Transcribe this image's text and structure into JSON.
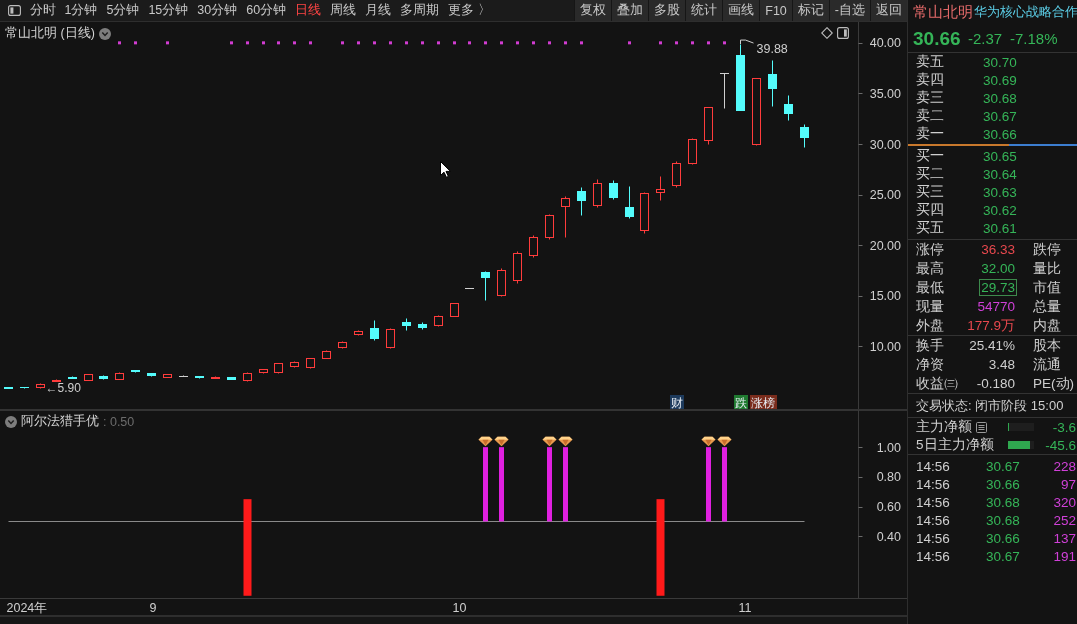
{
  "toolbar": {
    "periods": [
      {
        "label": "分时",
        "selected": false
      },
      {
        "label": "1分钟",
        "selected": false
      },
      {
        "label": "5分钟",
        "selected": false
      },
      {
        "label": "15分钟",
        "selected": false
      },
      {
        "label": "30分钟",
        "selected": false
      },
      {
        "label": "60分钟",
        "selected": false
      },
      {
        "label": "日线",
        "selected": true
      },
      {
        "label": "周线",
        "selected": false
      },
      {
        "label": "月线",
        "selected": false
      },
      {
        "label": "多周期",
        "selected": false
      },
      {
        "label": "更多 〉",
        "selected": false
      }
    ],
    "buttons": [
      "复权",
      "叠加",
      "多股",
      "统计",
      "画线",
      "F10",
      "标记",
      "-自选",
      "返回"
    ]
  },
  "main_chart": {
    "chart_data": [
      {
        "type": "candlestick",
        "title": "常山北明 (日线)",
        "categories": [
          null,
          null,
          null,
          null,
          null,
          null,
          null,
          null,
          null,
          null,
          null,
          null,
          null,
          null,
          null,
          null,
          null,
          null,
          null,
          null,
          null,
          null,
          null,
          null,
          null,
          null,
          null,
          null,
          null,
          null,
          null,
          null,
          null,
          null,
          null,
          null,
          null,
          null,
          null,
          null,
          null,
          null,
          null,
          null,
          null,
          null,
          null,
          null,
          null,
          null,
          null,
          null,
          null,
          null,
          null,
          null,
          null
        ],
        "tick_labels": "y",
        "ylim": [
          3.72,
          42.06
        ],
        "yticks": [
          {
            "value": 10,
            "label": "10.00"
          },
          {
            "value": 15,
            "label": "15.00"
          },
          {
            "value": 20,
            "label": "20.00"
          },
          {
            "value": 25,
            "label": "25.00"
          },
          {
            "value": 30,
            "label": "30.00"
          },
          {
            "value": 35,
            "label": "35.00"
          },
          {
            "value": 40,
            "label": "40.00"
          }
        ],
        "ohlc": [
          [
            5.98,
            6.0,
            5.92,
            5.94
          ],
          [
            5.98,
            6.0,
            5.93,
            5.95
          ],
          [
            5.95,
            6.35,
            5.9,
            6.3
          ],
          [
            6.6,
            6.78,
            6.55,
            6.7
          ],
          [
            7.0,
            7.05,
            6.85,
            6.9
          ],
          [
            6.7,
            7.3,
            6.65,
            7.25
          ],
          [
            7.1,
            7.15,
            6.8,
            6.85
          ],
          [
            6.8,
            7.45,
            6.75,
            7.4
          ],
          [
            7.65,
            7.7,
            7.5,
            7.55
          ],
          [
            7.35,
            7.4,
            7.1,
            7.15
          ],
          [
            7.0,
            7.3,
            6.95,
            7.25
          ],
          [
            7.1,
            7.15,
            7.05,
            7.1
          ],
          [
            7.05,
            7.1,
            6.9,
            6.95
          ],
          [
            6.9,
            7.05,
            6.85,
            7.0
          ],
          [
            6.95,
            7.0,
            6.75,
            6.8
          ],
          [
            6.7,
            7.45,
            6.6,
            7.4
          ],
          [
            7.45,
            7.8,
            7.4,
            7.75
          ],
          [
            7.5,
            8.4,
            7.4,
            8.35
          ],
          [
            8.1,
            8.6,
            8.0,
            8.5
          ],
          [
            8.0,
            8.9,
            7.9,
            8.85
          ],
          [
            8.9,
            9.6,
            8.85,
            9.55
          ],
          [
            9.9,
            10.5,
            9.8,
            10.4
          ],
          [
            11.2,
            11.6,
            11.1,
            11.5
          ],
          [
            11.8,
            12.6,
            10.6,
            10.8
          ],
          [
            9.9,
            11.8,
            9.8,
            11.7
          ],
          [
            12.4,
            12.8,
            11.6,
            12.1
          ],
          [
            12.2,
            12.4,
            11.7,
            11.9
          ],
          [
            12.1,
            13.1,
            12.0,
            13.0
          ],
          [
            13.0,
            14.3,
            13.0,
            14.3
          ],
          [
            15.73,
            15.73,
            15.73,
            15.73
          ],
          [
            17.35,
            17.5,
            14.6,
            16.86
          ],
          [
            15.1,
            17.8,
            15.0,
            17.6
          ],
          [
            16.6,
            19.4,
            16.3,
            19.2
          ],
          [
            19.0,
            21.0,
            18.8,
            20.8
          ],
          [
            20.8,
            23.1,
            20.6,
            23.0
          ],
          [
            23.9,
            24.9,
            20.8,
            24.7
          ],
          [
            25.4,
            25.8,
            23.0,
            24.5
          ],
          [
            24.0,
            26.5,
            23.8,
            26.2
          ],
          [
            26.2,
            26.4,
            24.6,
            24.8
          ],
          [
            23.8,
            25.9,
            22.7,
            22.9
          ],
          [
            21.5,
            25.3,
            21.2,
            25.2
          ],
          [
            25.3,
            26.8,
            24.5,
            25.6
          ],
          [
            26.0,
            28.3,
            25.8,
            28.1
          ],
          [
            28.1,
            30.6,
            28.0,
            30.5
          ],
          [
            30.4,
            33.66,
            30.0,
            33.66
          ],
          [
            37.03,
            37.03,
            33.6,
            37.03
          ],
          [
            38.8,
            39.88,
            33.4,
            33.4
          ],
          [
            30.0,
            36.5,
            29.9,
            36.5
          ],
          [
            36.9,
            38.3,
            33.75,
            35.5
          ],
          [
            34.0,
            34.84,
            32.4,
            33.03
          ],
          [
            31.7,
            32.0,
            29.73,
            30.66
          ],
          null,
          null,
          null,
          null,
          null,
          null
        ],
        "series": [
          {
            "type": "scatter",
            "color": "#d23cd2",
            "values": [
              null,
              null,
              null,
              null,
              null,
              null,
              null,
              40,
              40,
              null,
              40,
              null,
              null,
              null,
              40,
              40,
              40,
              40,
              40,
              40,
              null,
              40,
              40,
              40,
              40,
              40,
              40,
              40,
              40,
              40,
              40,
              40,
              40,
              40,
              40,
              40,
              40,
              null,
              null,
              40,
              null,
              40,
              40,
              40,
              40,
              40,
              null,
              null,
              null,
              null,
              null,
              null,
              null,
              null,
              null,
              null,
              null
            ]
          }
        ],
        "annotations": [
          "←5.90",
          "39.88"
        ]
      }
    ],
    "event_tags": [
      {
        "text": "财",
        "color": "#1d3a5c"
      },
      {
        "text": "跌",
        "color": "#1f7a30"
      },
      {
        "text": "涨榜",
        "color": "#7a2c1c"
      }
    ]
  },
  "indicator": {
    "reading": ": 0.50",
    "chart_data": [
      {
        "type": "bar",
        "title": "阿尔法猎手优",
        "categories": [
          "2024年",
          null,
          null,
          null,
          null,
          null,
          null,
          null,
          null,
          "9",
          null,
          null,
          null,
          null,
          null,
          null,
          null,
          null,
          null,
          null,
          null,
          null,
          null,
          null,
          null,
          null,
          null,
          null,
          "10",
          null,
          null,
          null,
          null,
          null,
          null,
          null,
          null,
          null,
          null,
          null,
          null,
          null,
          null,
          null,
          null,
          null,
          "11",
          null,
          null,
          null,
          null,
          null,
          null,
          null,
          null,
          null,
          null
        ],
        "ylim": [
          -0.015,
          1.25
        ],
        "yticks": [
          {
            "value": 0.4,
            "label": "0.40"
          },
          {
            "value": 0.6,
            "label": "0.60"
          },
          {
            "value": 0.8,
            "label": "0.80"
          },
          {
            "value": 1,
            "label": "1.00"
          }
        ],
        "series": [
          {
            "color": "#ff1a1a",
            "values": [
              null,
              null,
              null,
              null,
              null,
              null,
              null,
              null,
              null,
              null,
              null,
              null,
              null,
              null,
              null,
              0.65,
              null,
              null,
              null,
              null,
              null,
              null,
              null,
              null,
              null,
              null,
              null,
              null,
              null,
              null,
              null,
              null,
              null,
              null,
              null,
              null,
              null,
              null,
              null,
              null,
              null,
              0.65,
              null,
              null,
              null,
              null,
              null,
              null,
              null,
              null,
              null,
              null,
              null,
              null,
              null,
              null,
              null
            ]
          },
          {
            "color": "#e020e0",
            "base": [
              null,
              null,
              null,
              null,
              null,
              null,
              null,
              null,
              null,
              null,
              null,
              null,
              null,
              null,
              null,
              null,
              null,
              null,
              null,
              null,
              null,
              null,
              null,
              null,
              null,
              null,
              null,
              null,
              null,
              null,
              0.5,
              0.5,
              null,
              null,
              0.5,
              0.5,
              null,
              null,
              null,
              null,
              null,
              null,
              null,
              null,
              0.5,
              0.5,
              null,
              null,
              null,
              null,
              null,
              null,
              null,
              null,
              null,
              null,
              null
            ],
            "values": [
              null,
              null,
              null,
              null,
              null,
              null,
              null,
              null,
              null,
              null,
              null,
              null,
              null,
              null,
              null,
              null,
              null,
              null,
              null,
              null,
              null,
              null,
              null,
              null,
              null,
              null,
              null,
              null,
              null,
              null,
              0.5,
              0.5,
              null,
              null,
              0.5,
              0.5,
              null,
              null,
              null,
              null,
              null,
              null,
              null,
              null,
              0.5,
              0.5,
              null,
              null,
              null,
              null,
              null,
              null,
              null,
              null,
              null,
              null,
              null
            ]
          }
        ],
        "ref_lines": [
          {
            "axis": "y",
            "value": 0.5,
            "color": "#8a8a8a"
          }
        ]
      }
    ]
  },
  "quote_panel": {
    "name": "常山北明",
    "tag": "华为核心战略合作",
    "price": "30.66",
    "change": "-2.37",
    "change_pct": "-7.18%",
    "asks": [
      {
        "label": "卖五",
        "price": "30.70"
      },
      {
        "label": "卖四",
        "price": "30.69"
      },
      {
        "label": "卖三",
        "price": "30.68"
      },
      {
        "label": "卖二",
        "price": "30.67"
      },
      {
        "label": "卖一",
        "price": "30.66"
      }
    ],
    "ratio_bar": {
      "level": 0.6
    },
    "bids": [
      {
        "label": "买一",
        "price": "30.65"
      },
      {
        "label": "买二",
        "price": "30.64"
      },
      {
        "label": "买三",
        "price": "30.63"
      },
      {
        "label": "买四",
        "price": "30.62"
      },
      {
        "label": "买五",
        "price": "30.61"
      }
    ],
    "stats": [
      {
        "label": "涨停",
        "value": "36.33",
        "color": "#e8484e",
        "boxed": false,
        "side_label": "跌停"
      },
      {
        "label": "最高",
        "value": "32.00",
        "color": "#35b558",
        "boxed": false,
        "side_label": "量比"
      },
      {
        "label": "最低",
        "value": "29.73",
        "color": "#35b558",
        "boxed": true,
        "side_label": "市值"
      },
      {
        "label": "现量",
        "value": "54770",
        "color": "#d040d8",
        "boxed": false,
        "side_label": "总量"
      },
      {
        "label": "外盘",
        "value": "177.9万",
        "color": "#e8484e",
        "boxed": false,
        "side_label": "内盘"
      }
    ],
    "fundamentals": [
      {
        "label": "换手",
        "value": "25.41%",
        "side_label": "股本"
      },
      {
        "label": "净资",
        "value": "3.48",
        "side_label": "流通"
      },
      {
        "label": "收益㈢",
        "value": "-0.180",
        "side_label": "PE(动)"
      }
    ],
    "status": "交易状态: 闭市阶段 15:00",
    "fund_flow": [
      {
        "label": "主力净额",
        "kind": "detail",
        "level": 0.04,
        "value": "-3.6"
      },
      {
        "label": "5日主力净额",
        "kind": "plain",
        "level": 0.85,
        "value": "-45.6"
      }
    ],
    "ticks": [
      {
        "time": "14:56",
        "price": "30.67",
        "volume": "228"
      },
      {
        "time": "14:56",
        "price": "30.66",
        "volume": "97"
      },
      {
        "time": "14:56",
        "price": "30.68",
        "volume": "320"
      },
      {
        "time": "14:56",
        "price": "30.68",
        "volume": "252"
      },
      {
        "time": "14:56",
        "price": "30.66",
        "volume": "137"
      },
      {
        "time": "14:56",
        "price": "30.67",
        "volume": "191"
      }
    ]
  }
}
